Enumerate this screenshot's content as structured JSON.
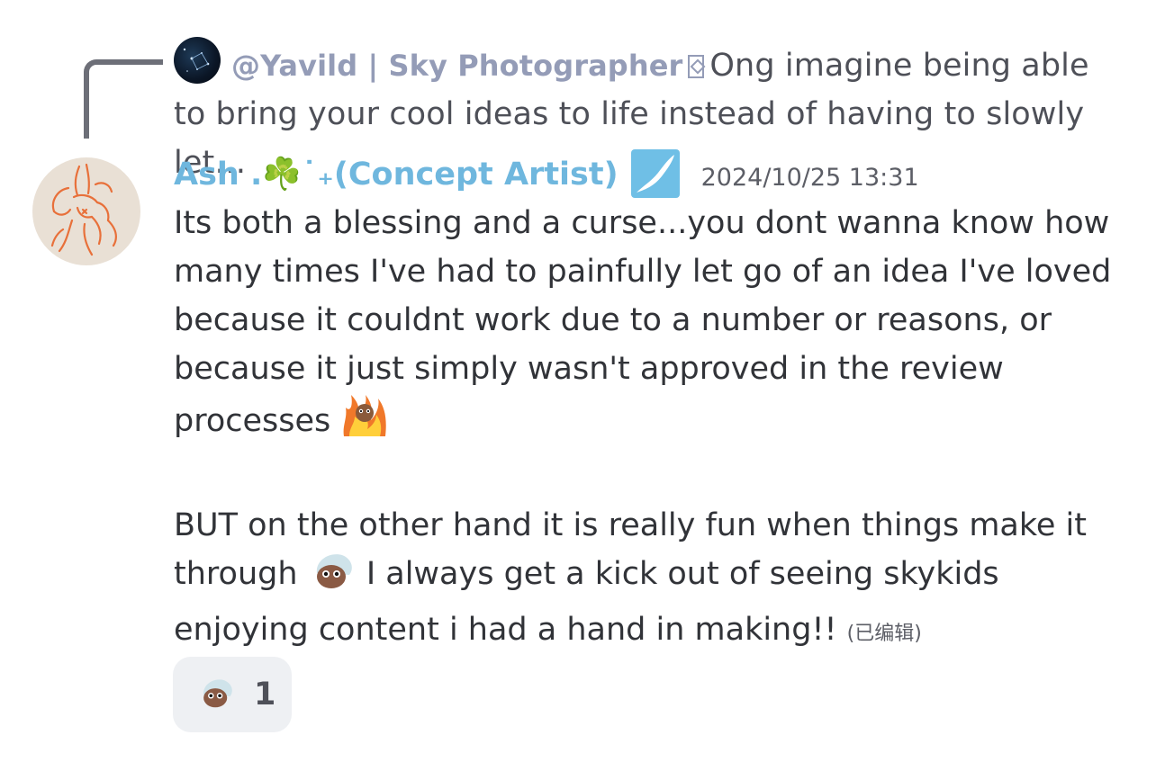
{
  "reply": {
    "author": "@Yavild | Sky Photographer",
    "badge_icon": "diamond-badge-icon",
    "preview": "Ong imagine being able to bring your cool ideas to life instead of having to slowly let…"
  },
  "message": {
    "author": "Ash .☘️˙₊(Concept Artist)",
    "role_icon": "brush-role-icon",
    "timestamp": "2024/10/25 13:31",
    "paragraph1": "Its both a blessing and a curse...you dont wanna know how many times I've had to painfully let go of an idea I've loved because it couldnt work due to a number or reasons, or because it just simply wasn't approved in the review processes",
    "emoji1": "fire-character-emoji",
    "paragraph2_a": "BUT on the other hand it is really fun when things make it through",
    "emoji2": "skykid-emoji",
    "paragraph2_b": " I always get a kick out of seeing skykids enjoying content i had a hand in making!!",
    "edited_label": "(已编辑)"
  },
  "reaction": {
    "emoji": "skykid-emoji",
    "count": "1"
  },
  "colors": {
    "author": "#6fb7de",
    "reply_author": "#949cb7",
    "text": "#313338",
    "reaction_bg": "#eef0f3"
  }
}
